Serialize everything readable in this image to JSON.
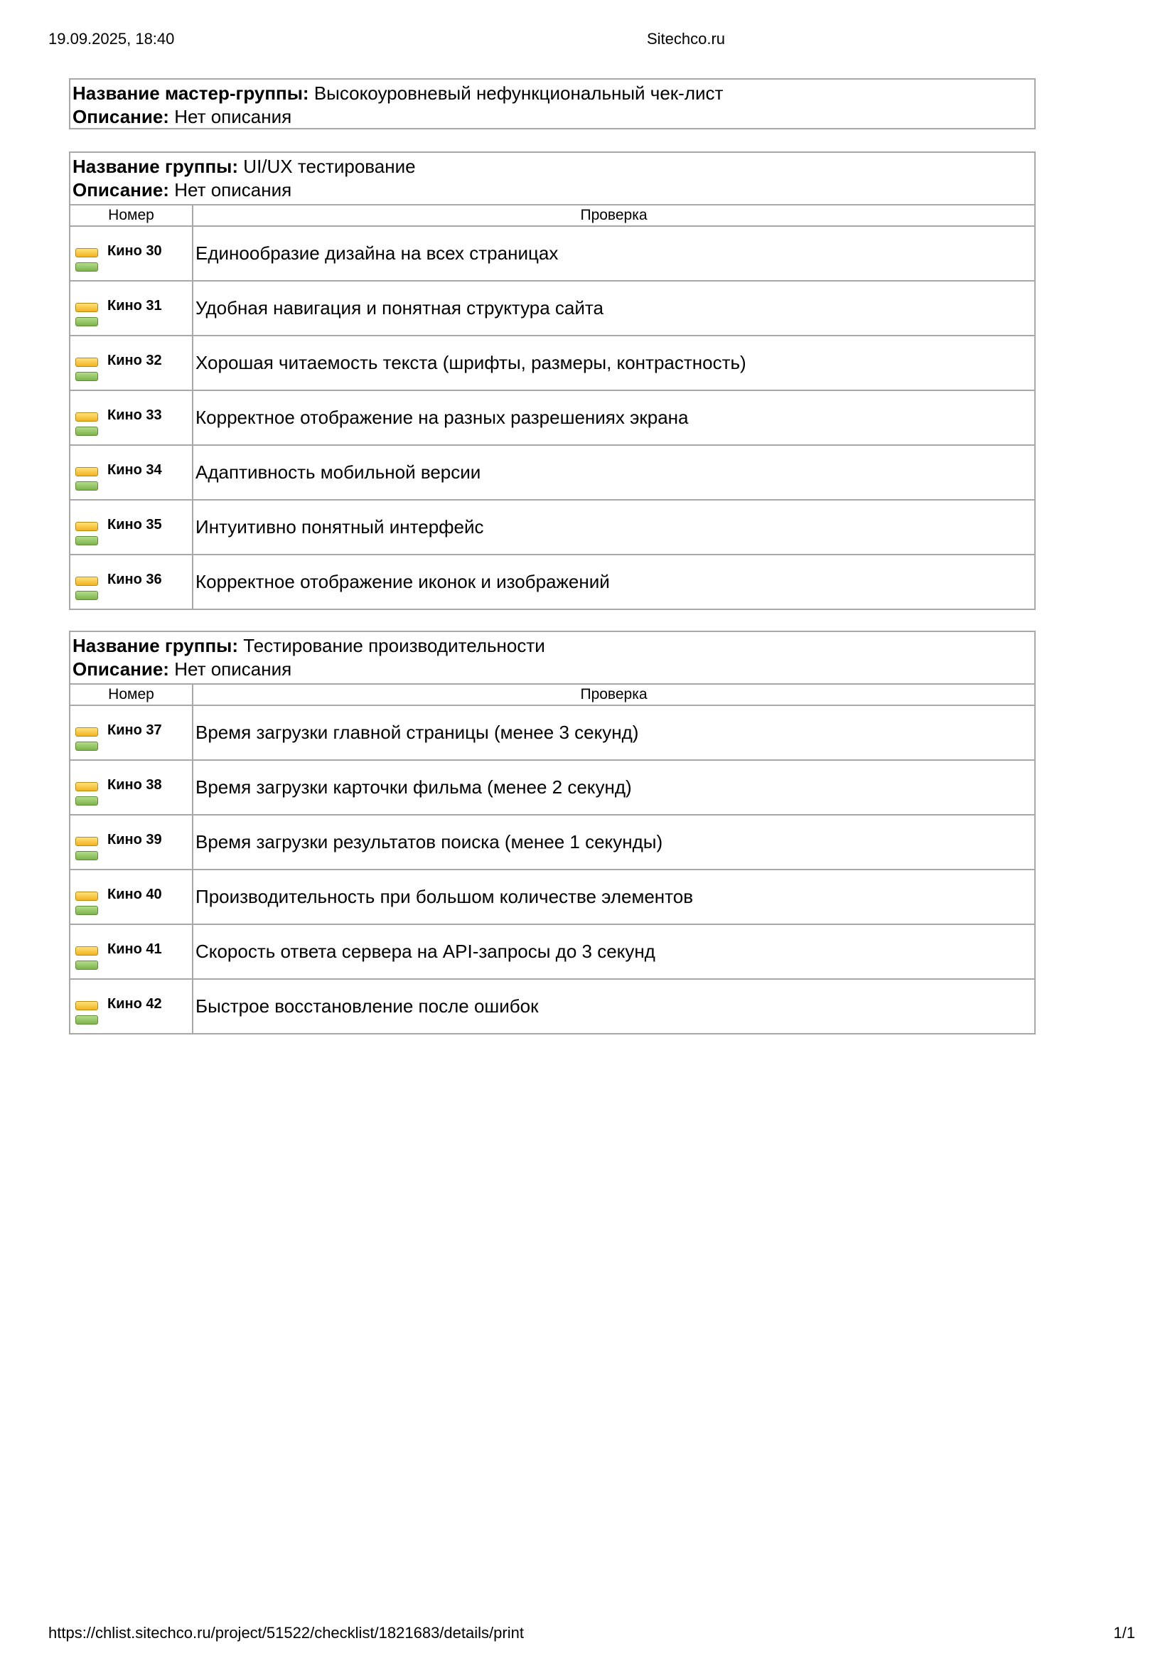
{
  "print_header": {
    "datetime": "19.09.2025, 18:40",
    "site": "Sitechco.ru"
  },
  "print_footer": {
    "url": "https://chlist.sitechco.ru/project/51522/checklist/1821683/details/print",
    "page": "1/1"
  },
  "master_group": {
    "name_label": "Название мастер-группы:",
    "name": "Высокоуровневый нефункциональный чек-лист",
    "desc_label": "Описание:",
    "desc": "Нет описания"
  },
  "groups": [
    {
      "name_label": "Название группы:",
      "name": "UI/UX тестирование",
      "desc_label": "Описание:",
      "desc": "Нет описания",
      "col_number": "Номер",
      "col_check": "Проверка",
      "rows": [
        {
          "num": "Кино 30",
          "text": "Единообразие дизайна на всех страницах"
        },
        {
          "num": "Кино 31",
          "text": "Удобная навигация и понятная структура сайта"
        },
        {
          "num": "Кино 32",
          "text": "Хорошая читаемость текста (шрифты, размеры, контрастность)"
        },
        {
          "num": "Кино 33",
          "text": "Корректное отображение на разных разрешениях экрана"
        },
        {
          "num": "Кино 34",
          "text": "Адаптивность мобильной версии"
        },
        {
          "num": "Кино 35",
          "text": "Интуитивно понятный интерфейс"
        },
        {
          "num": "Кино 36",
          "text": "Корректное отображение иконок и изображений"
        }
      ]
    },
    {
      "name_label": "Название группы:",
      "name": "Тестирование производительности",
      "desc_label": "Описание:",
      "desc": "Нет описания",
      "col_number": "Номер",
      "col_check": "Проверка",
      "rows": [
        {
          "num": "Кино 37",
          "text": "Время загрузки главной страницы (менее 3 секунд)"
        },
        {
          "num": "Кино 38",
          "text": "Время загрузки карточки фильма (менее 2 секунд)"
        },
        {
          "num": "Кино 39",
          "text": "Время загрузки результатов поиска (менее 1 секунды)"
        },
        {
          "num": "Кино 40",
          "text": "Производительность при большом количестве элементов"
        },
        {
          "num": "Кино 41",
          "text": "Скорость ответа сервера на API-запросы до 3 секунд"
        },
        {
          "num": "Кино 42",
          "text": "Быстрое восстановление после ошибок"
        }
      ]
    }
  ],
  "colors": {
    "border": "#a8a8a8",
    "status_yellow": "#f7c843",
    "status_green": "#8fc35b"
  },
  "icons": [
    "status-yellow-icon",
    "status-green-icon"
  ]
}
